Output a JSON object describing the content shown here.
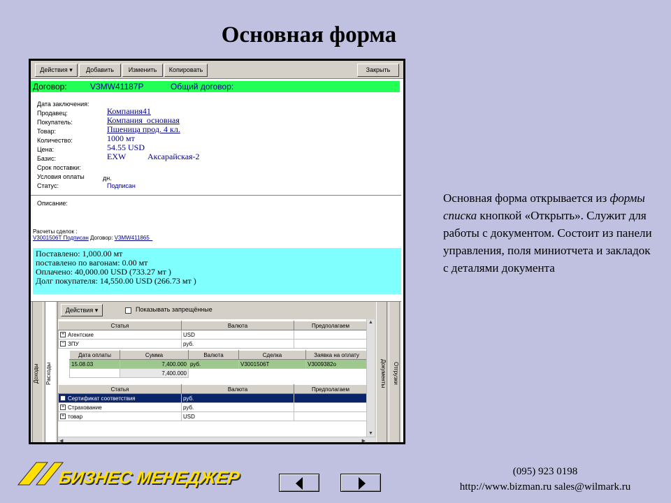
{
  "slide": {
    "title": "Основная форма",
    "description_1": "Основная форма открывается из ",
    "description_italic": "формы списка",
    "description_2": " кнопкой «Открыть». Служит для работы с документом. Состоит из панели управления, поля миниотчета и закладок с деталями документа",
    "phone": "(095) 923 0198",
    "contacts": "http://www.bizman.ru  sales@wilmark.ru",
    "logo_text": "БИЗНЕС МЕНЕДЖЕР"
  },
  "toolbar": {
    "actions": "Действия ▾",
    "add": "Добавить",
    "edit": "Изменить",
    "copy": "Копировать",
    "close": "Закрыть"
  },
  "contract": {
    "label": "Договор:",
    "number": "V3MW41187P",
    "type": "Общий договор:"
  },
  "fields": {
    "date_label": "Дата заключения:",
    "seller_label": "Продавец:",
    "seller": "Компания41",
    "buyer_label": "Покупатель:",
    "buyer": "Компания_основная",
    "goods_label": "Товар:",
    "goods": "Пшеница прод. 4 кл.",
    "qty_label": "Количество:",
    "qty": "1000  мт",
    "price_label": "Цена:",
    "price": "54.55  USD",
    "basis_label": "Базис:",
    "basis": "EXW",
    "basis_place": "Аксарайская-2",
    "term_label": "Срок поставки:",
    "payment_label": "Условия оплаты",
    "payment": "дн.",
    "status_label": "Статус:",
    "status": "Подписан"
  },
  "description_label": "Описание:",
  "settlements": {
    "label": "Расчеты сделок :",
    "deal": "V3001506T Подписан",
    "contract_label": " Договор: ",
    "contract": "V3MW411865_"
  },
  "mini_report": {
    "line1": "Поставлено: 1,000.00 мт",
    "line2": " поставлено по вагонам: 0.00 мт",
    "line3": " Оплачено: 40,000.00 USD  (733.27 мт )",
    "line4": "Долг покупателя: 14,550.00 USD  (266.73 мт )"
  },
  "tabs": {
    "left1": "Доходы",
    "left2": "Расходы",
    "right1": "Документы",
    "right2": "Отгрузки"
  },
  "grid": {
    "actions": "Действия ▾",
    "show_forbidden": "Показывать запрещённые",
    "headers": [
      "Статья",
      "Валюта",
      "Предполагаем"
    ],
    "rows_top": [
      {
        "pm": "+",
        "article": "Агентские",
        "currency": "USD"
      },
      {
        "pm": "−",
        "article": "ЗПУ",
        "currency": "руб."
      }
    ],
    "sub_headers": [
      "Дата оплаты",
      "Сумма",
      "Валюта",
      "Сделка",
      "Заявка на оплату"
    ],
    "sub_row": [
      "15.08.03",
      "7,400.000",
      "руб.",
      "V3001506T",
      "V3009382o"
    ],
    "sub_total": "7,400.000",
    "rows_bottom": [
      {
        "pm": "+",
        "article": "Сертификат соответствия",
        "currency": "руб."
      },
      {
        "pm": "+",
        "article": "Страхование",
        "currency": "руб."
      },
      {
        "pm": "+",
        "article": "товар",
        "currency": "USD"
      }
    ]
  }
}
